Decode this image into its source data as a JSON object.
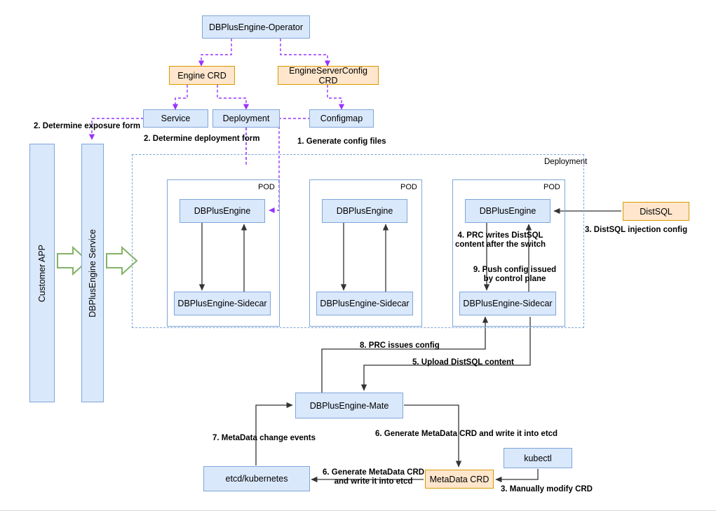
{
  "diagram": {
    "title": "DBPlusEngine Kubernetes Operator Architecture",
    "colors": {
      "blue_fill": "#dae8fc",
      "blue_stroke": "#7ea6d9",
      "orange_fill": "#ffe6cc",
      "orange_stroke": "#d79b00",
      "purple_arrow": "#9933ff",
      "green_arrow": "#82b366",
      "black_arrow": "#333333"
    },
    "nodes": {
      "operator": "DBPlusEngine-Operator",
      "engine_crd": "Engine CRD",
      "engine_server_config_crd": "EngineServerConfig CRD",
      "service": "Service",
      "deployment_box": "Deployment",
      "configmap": "Configmap",
      "customer_app": "Customer APP",
      "dbplusengine_service": "DBPlusEngine Service",
      "deployment_container": "Deployment",
      "pod": "POD",
      "dbplusengine": "DBPlusEngine",
      "sidecar": "DBPlusEngine-Sidecar",
      "distsql": "DistSQL",
      "mate": "DBPlusEngine-Mate",
      "etcd": "etcd/kubernetes",
      "metadata_crd": "MetaData CRD",
      "kubectl": "kubectl"
    },
    "pods": [
      {
        "label": "POD",
        "engine": "DBPlusEngine",
        "sidecar": "DBPlusEngine-Sidecar"
      },
      {
        "label": "POD",
        "engine": "DBPlusEngine",
        "sidecar": "DBPlusEngine-Sidecar"
      },
      {
        "label": "POD",
        "engine": "DBPlusEngine",
        "sidecar": "DBPlusEngine-Sidecar"
      }
    ],
    "edge_labels": {
      "determine_exposure": "2. Determine exposure form",
      "determine_deployment": "2. Determine deployment form",
      "generate_config_files": "1. Generate config files",
      "distsql_injection": "3. DistSQL injection config",
      "prc_writes_line1": "4. PRC writes DistSQL",
      "prc_writes_line2": "content after the switch",
      "push_config_line1": "9. Push config issued",
      "push_config_line2": "by control plane",
      "prc_issues_config": "8. PRC issues config",
      "upload_distsql": "5. Upload DistSQL content",
      "metadata_change_events": "7. MetaData change events",
      "generate_metadata_crd": "6. Generate MetaData CRD and write it into etcd",
      "generate_metadata_crd_line1": "6. Generate MetaData CRD",
      "generate_metadata_crd_line2": "and write it into etcd",
      "manually_modify_crd": "3. Manually modify CRD"
    }
  }
}
